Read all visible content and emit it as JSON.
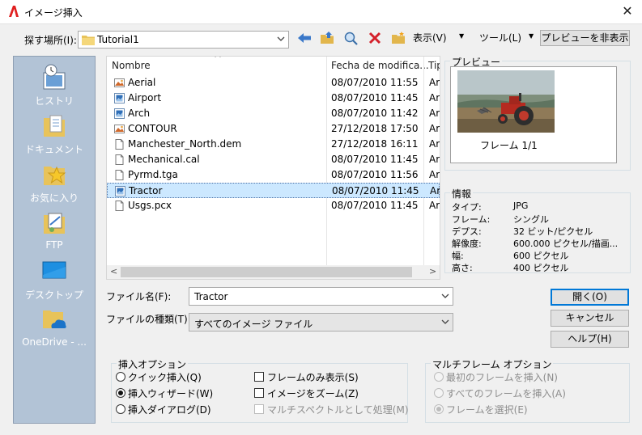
{
  "window": {
    "title": "イメージ挿入",
    "close_glyph": "✕"
  },
  "lookin": {
    "label": "探す場所(I):",
    "value": "Tutorial1"
  },
  "toolbar": {
    "view_label": "表示(V)",
    "tools_label": "ツール(L)",
    "dropdown_glyph": "▼",
    "preview_toggle_label": "プレビューを非表示"
  },
  "places": [
    {
      "label": "ヒストリ",
      "icon": "history-icon"
    },
    {
      "label": "ドキュメント",
      "icon": "documents-icon"
    },
    {
      "label": "お気に入り",
      "icon": "favorites-icon"
    },
    {
      "label": "FTP",
      "icon": "ftp-icon"
    },
    {
      "label": "デスクトップ",
      "icon": "desktop-icon"
    },
    {
      "label": "OneDrive - ...",
      "icon": "onedrive-icon"
    }
  ],
  "filelist": {
    "sort_glyph": "^",
    "columns": [
      "Nombre",
      "Fecha de modifica...",
      "Tip"
    ],
    "rows": [
      {
        "name": "Aerial",
        "date": "08/07/2010 11:55",
        "type": "Arc",
        "icon": "image-file-icon"
      },
      {
        "name": "Airport",
        "date": "08/07/2010 11:45",
        "type": "Arc",
        "icon": "jpg-file-icon"
      },
      {
        "name": "Arch",
        "date": "08/07/2010 11:42",
        "type": "Arc",
        "icon": "jpg-file-icon"
      },
      {
        "name": "CONTOUR",
        "date": "27/12/2018 17:50",
        "type": "Arc",
        "icon": "image-file-icon"
      },
      {
        "name": "Manchester_North.dem",
        "date": "27/12/2018 16:11",
        "type": "Arc",
        "icon": "blank-file-icon"
      },
      {
        "name": "Mechanical.cal",
        "date": "08/07/2010 11:45",
        "type": "Arc",
        "icon": "blank-file-icon"
      },
      {
        "name": "Pyrmd.tga",
        "date": "08/07/2010 11:56",
        "type": "Arc",
        "icon": "blank-file-icon"
      },
      {
        "name": "Tractor",
        "date": "08/07/2010 11:45",
        "type": "Arc",
        "icon": "jpg-file-icon"
      },
      {
        "name": "Usgs.pcx",
        "date": "08/07/2010 11:45",
        "type": "Arc",
        "icon": "blank-file-icon"
      }
    ],
    "selected_index": 7,
    "scroll_left_glyph": "<",
    "scroll_right_glyph": ">"
  },
  "preview": {
    "title": "プレビュー",
    "frame_label": "フレーム 1/1"
  },
  "info": {
    "title": "情報",
    "rows": [
      {
        "label": "タイプ:",
        "value": "JPG"
      },
      {
        "label": "フレーム:",
        "value": "シングル"
      },
      {
        "label": "デプス:",
        "value": "32 ビット/ピクセル"
      },
      {
        "label": "解像度:",
        "value": "600.000 ピクセル/描画..."
      },
      {
        "label": "幅:",
        "value": "600 ピクセル"
      },
      {
        "label": "高さ:",
        "value": "400 ピクセル"
      }
    ]
  },
  "filename": {
    "label": "ファイル名(F):",
    "value": "Tractor"
  },
  "filetype": {
    "label": "ファイルの種類(T):",
    "value": "すべてのイメージ ファイル"
  },
  "buttons": {
    "open": "開く(O)",
    "cancel": "キャンセル",
    "help": "ヘルプ(H)"
  },
  "insert_options": {
    "title": "挿入オプション",
    "radios": [
      {
        "label": "クイック挿入(Q)",
        "checked": false
      },
      {
        "label": "挿入ウィザード(W)",
        "checked": true
      },
      {
        "label": "挿入ダイアログ(D)",
        "checked": false
      }
    ],
    "checks": [
      {
        "label": "フレームのみ表示(S)",
        "checked": false,
        "disabled": false
      },
      {
        "label": "イメージをズーム(Z)",
        "checked": false,
        "disabled": false
      },
      {
        "label": "マルチスペクトルとして処理(M)",
        "checked": false,
        "disabled": true
      }
    ]
  },
  "multiframe_options": {
    "title": "マルチフレーム オプション",
    "radios": [
      {
        "label": "最初のフレームを挿入(N)",
        "checked": false
      },
      {
        "label": "すべてのフレームを挿入(A)",
        "checked": false
      },
      {
        "label": "フレームを選択(E)",
        "checked": true
      }
    ]
  }
}
